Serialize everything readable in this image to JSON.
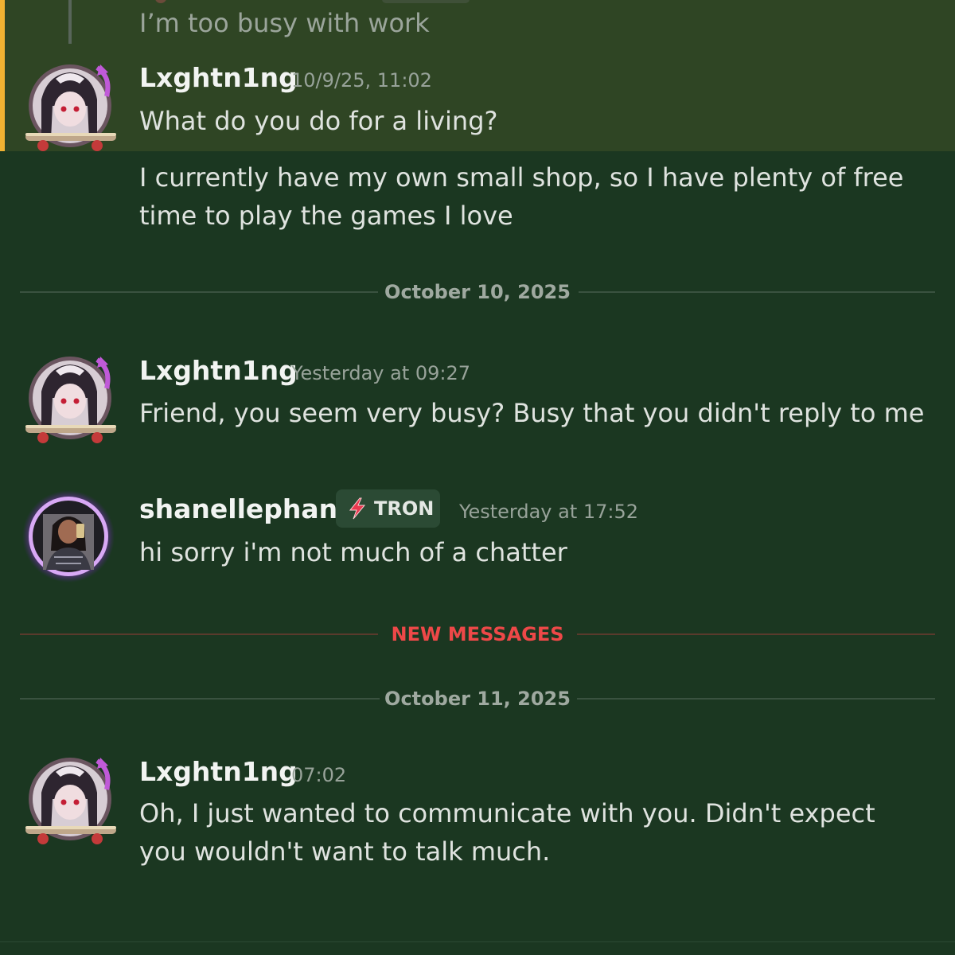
{
  "colors": {
    "background": "#1b3721",
    "highlight": "#2f4524",
    "highlight_bar": "#f0b232",
    "new_messages": "#ee4848",
    "timestamp": "#98a39a"
  },
  "reply_preview": {
    "text": "I’m too busy with work"
  },
  "dividers": {
    "oct10": "October 10, 2025",
    "new_messages": "NEW MESSAGES",
    "oct11": "October 11, 2025"
  },
  "messages": [
    {
      "author": "Lxghtn1ng",
      "timestamp": "10/9/25, 11:02",
      "lines": [
        "What do you do for a living?"
      ],
      "highlighted": true
    },
    {
      "author": "",
      "timestamp": "",
      "lines": [
        "I currently have my own small shop, so I have plenty of free time to play the games I love"
      ]
    },
    {
      "author": "Lxghtn1ng",
      "timestamp": "Yesterday at 09:27",
      "lines": [
        "Friend, you seem very busy? Busy that you didn't reply to me"
      ]
    },
    {
      "author": "shanellephant",
      "tag": {
        "icon": "lightning-bolt-icon",
        "label": "TRON"
      },
      "timestamp": "Yesterday at 17:52",
      "lines": [
        "hi sorry i'm not much of a chatter"
      ]
    },
    {
      "author": "Lxghtn1ng",
      "timestamp": "07:02",
      "lines": [
        "Oh, I just wanted to communicate with you. Didn't expect you wouldn't want to talk much."
      ]
    }
  ]
}
